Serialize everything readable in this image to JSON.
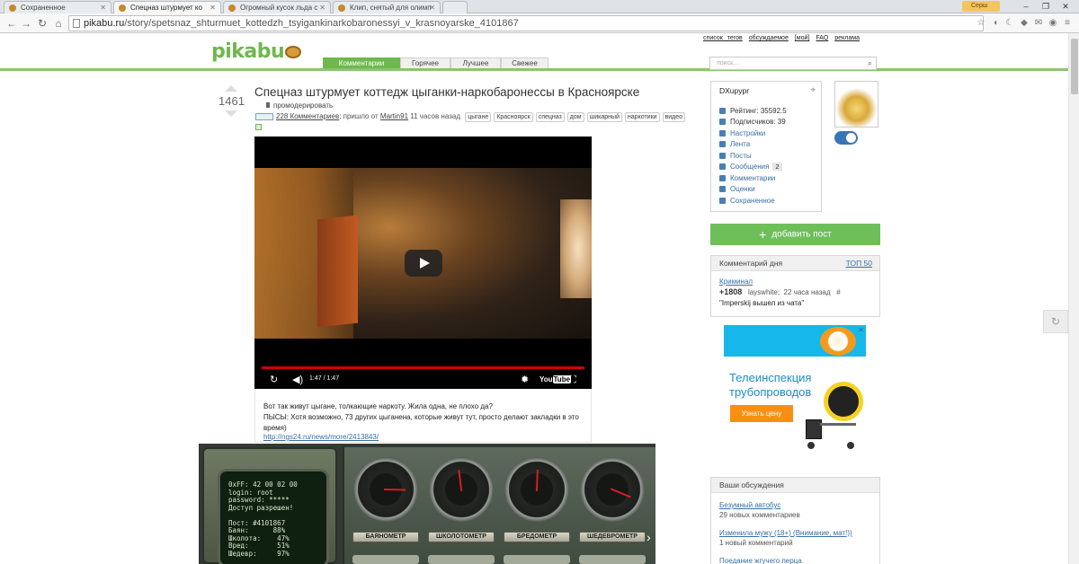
{
  "browser": {
    "tabs": [
      {
        "title": "Сохраненное",
        "active": false
      },
      {
        "title": "Спецназ штурмует ко",
        "active": true
      },
      {
        "title": "Огромный кусок льда с",
        "active": false
      },
      {
        "title": "Клип, снятый для олимп",
        "active": false
      }
    ],
    "user_chip": "Серш",
    "url_host": "pikabu.ru",
    "url_path": "/story/spetsnaz_shturmuet_kottedzh_tsyigankinarkobaronessyi_v_krasnoyarske_4101867"
  },
  "site": {
    "logo_text": "pikabu",
    "top_links": [
      "список тегов",
      "обсуждаемое",
      "[мой]",
      "FAQ",
      "реклама"
    ],
    "nav_tabs": [
      {
        "label": "Комментарии",
        "active": true
      },
      {
        "label": "Горячее",
        "active": false
      },
      {
        "label": "Лучшее",
        "active": false
      },
      {
        "label": "Свежее",
        "active": false
      }
    ],
    "search_placeholder": "поиск..."
  },
  "post": {
    "rating": "1461",
    "title": "Спецназ штурмует коттедж цыганки-наркобаронессы в Красноярске",
    "moderate_label": "промодерировать",
    "comments_link": "228 Комментариев",
    "posted_by_prefix": "; пришло от",
    "author": "Martin91",
    "time_ago": "11 часов назад",
    "tags": [
      "цыгане",
      "Красноярск",
      "спецназ",
      "дом",
      "шикарный",
      "наркотики",
      "видео"
    ],
    "video_time": "1:47 / 1:47",
    "body_line1": "Вот так живут цыгане, толкающие наркоту. Жила одна, не плохо да?",
    "body_line2": "ПЫСЫ: Хотя возможно, 73 других цыганена, которые живут тут, просто делают закладки в это время)",
    "link": "http://ngs24.ru/news/more/2413843/"
  },
  "widget": {
    "terminal_lines": [
      "0xFF: 42 00 02 00",
      "login: root",
      "password: *****",
      "Доступ разрешен!",
      "",
      "Пост: #4101867",
      "Баян:      88%",
      "Школота:    47%",
      "Вред:       51%",
      "Шедевр:     97%"
    ],
    "gauges": [
      {
        "label": "БАЯНОМЕТР",
        "value": 88
      },
      {
        "label": "ШКОЛОТОМЕТР",
        "value": 47
      },
      {
        "label": "БРЕДОМЕТР",
        "value": 51
      },
      {
        "label": "ШЕДЕВРОМЕТР",
        "value": 97
      }
    ]
  },
  "sidebar": {
    "username": "DXupypr",
    "rating": "Рейтинг: 35592.5",
    "subscribers": "Подписчиков: 39",
    "menu": [
      "Настройки",
      "Лента",
      "Посты",
      "Сообщения",
      "Комментарии",
      "Оценки",
      "Сохраненное"
    ],
    "messages_count": "2",
    "add_post": "добавить пост",
    "comment_of_day": {
      "header": "Комментарий дня",
      "top_link": "ТОП 50",
      "category": "Криминал",
      "score": "+1808",
      "user": "layswhite;",
      "time": "22 часа назад",
      "hash": "#",
      "quote": "\"Imperskij вышел из чата\""
    },
    "ad": {
      "title_line1": "Телеинспекция",
      "title_line2": "трубопроводов",
      "button": "Узнать цену"
    },
    "discussions": {
      "header": "Ваши обсуждения",
      "items": [
        {
          "title": "Безумный автобус",
          "count": "29 новых комментариев"
        },
        {
          "title": "Изменила мужу (18+) (Внимание, мат!))",
          "count": "1 новый комментарий"
        },
        {
          "title": "Поедание жгучего перца",
          "count": ""
        }
      ]
    }
  }
}
